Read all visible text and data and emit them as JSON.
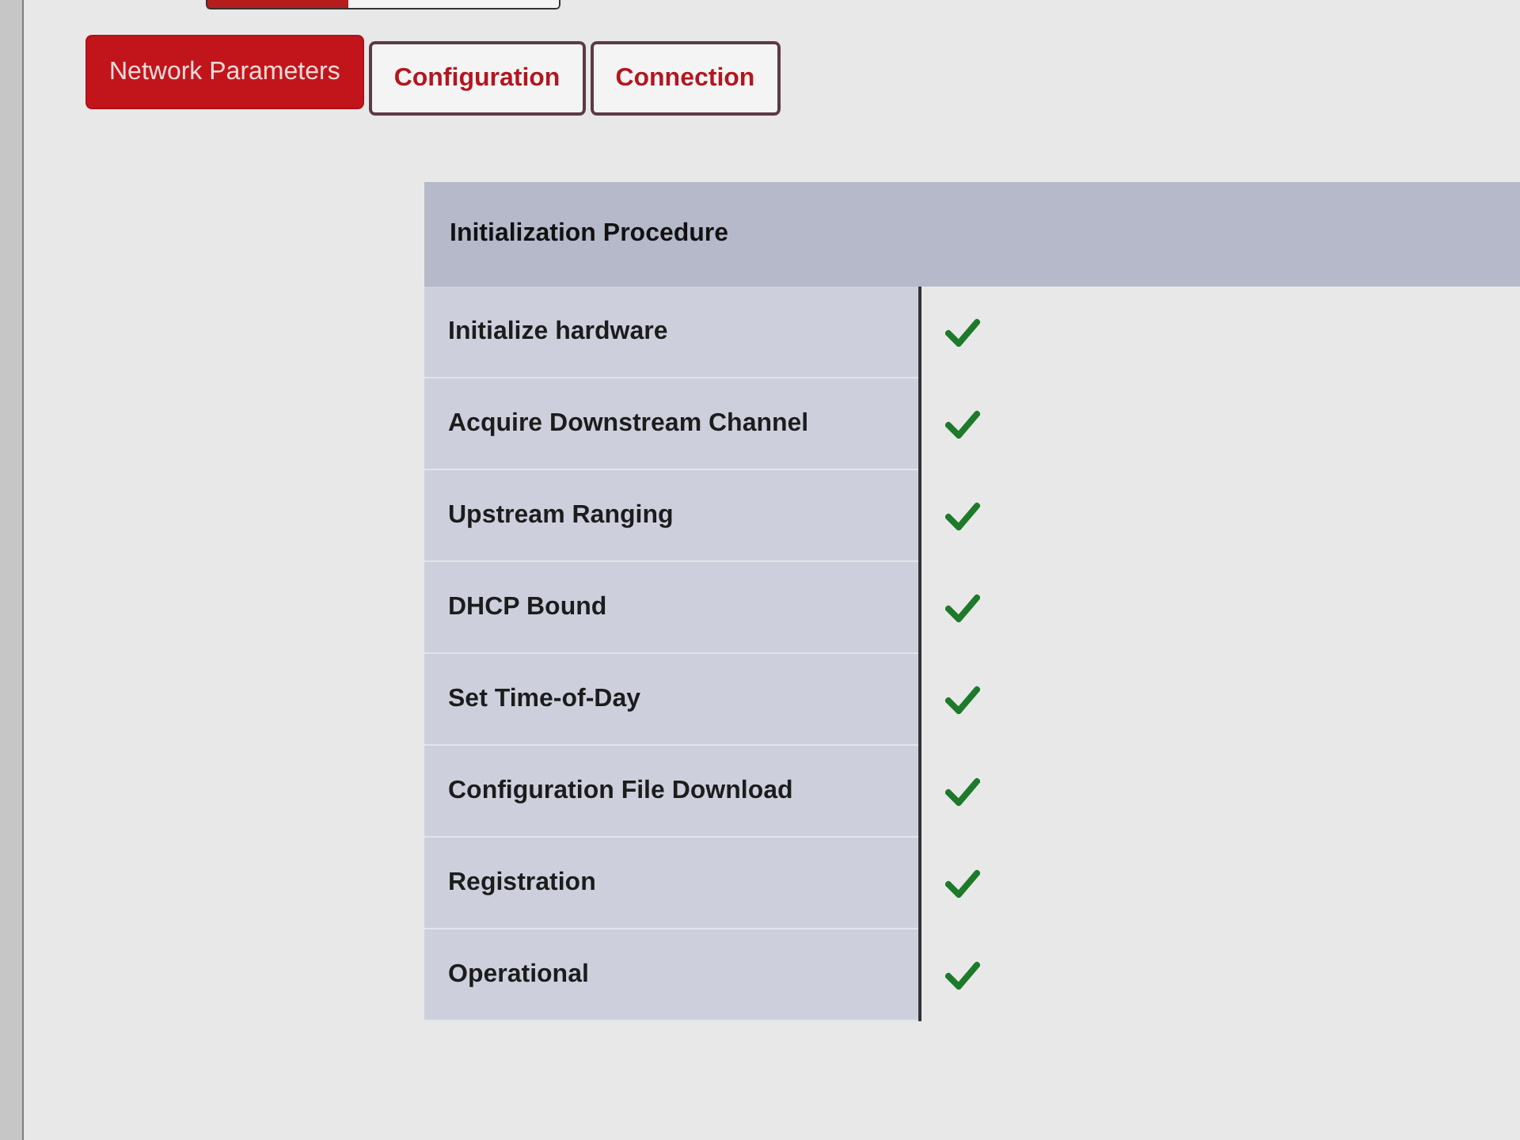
{
  "tabs": [
    {
      "label": "Network Parameters",
      "selected": true
    },
    {
      "label": "Configuration",
      "selected": false
    },
    {
      "label": "Connection",
      "selected": false
    }
  ],
  "procedure": {
    "title": "Initialization Procedure",
    "steps": [
      {
        "label": "Initialize hardware",
        "done": true
      },
      {
        "label": "Acquire Downstream Channel",
        "done": true
      },
      {
        "label": "Upstream Ranging",
        "done": true
      },
      {
        "label": "DHCP Bound",
        "done": true
      },
      {
        "label": "Set Time-of-Day",
        "done": true
      },
      {
        "label": "Configuration File Download",
        "done": true
      },
      {
        "label": "Registration",
        "done": true
      },
      {
        "label": "Operational",
        "done": true
      }
    ]
  }
}
